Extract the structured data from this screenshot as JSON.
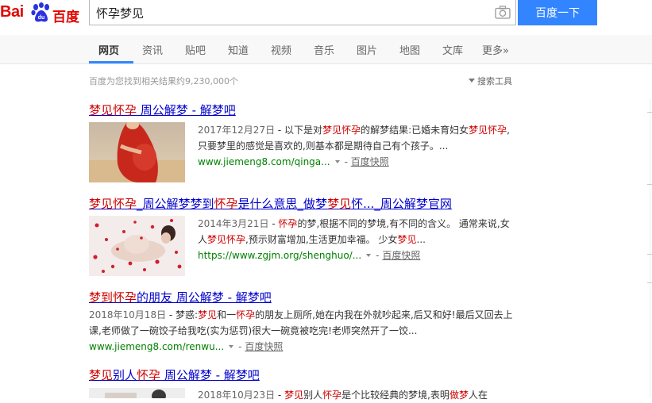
{
  "logo": {
    "latin": "Bai",
    "chinese": "百度"
  },
  "search": {
    "query": "怀孕梦见",
    "button_label": "百度一下"
  },
  "tabs": [
    {
      "label": "网页"
    },
    {
      "label": "资讯"
    },
    {
      "label": "贴吧"
    },
    {
      "label": "知道"
    },
    {
      "label": "视频"
    },
    {
      "label": "音乐"
    },
    {
      "label": "图片"
    },
    {
      "label": "地图"
    },
    {
      "label": "文库"
    },
    {
      "label": "更多»"
    }
  ],
  "stats": {
    "text": "百度为您找到相关结果约9,230,000个",
    "tools_label": "搜索工具"
  },
  "results": [
    {
      "title_parts": [
        "梦见",
        "怀孕",
        " 周公解梦 - 解梦吧"
      ],
      "date": "2017年12月27日",
      "snippet_parts": [
        " - 以下是对",
        "梦见怀孕",
        "的解梦结果:已婚未育妇女",
        "梦见",
        "怀孕",
        ",只要梦里的感觉是喜欢的,则基本都是期待自己有个孩子。..."
      ],
      "url": "www.jiemeng8.com/qinga...",
      "snapshot": "百度快照"
    },
    {
      "title_parts": [
        "梦见怀孕",
        "_周公解梦梦到",
        "怀孕",
        "是什么意思_做梦",
        "梦见",
        "怀..._周公解梦官网"
      ],
      "date": "2014年3月21日",
      "snippet_parts": [
        " - ",
        "怀孕",
        "的梦,根据不同的梦境,有不同的含义。 通常来说,女人",
        "梦见怀孕",
        ",预示财富增加,生活更加幸福。 少女",
        "梦见",
        "..."
      ],
      "url": "https://www.zgjm.org/shenghuo/...",
      "snapshot": "百度快照"
    },
    {
      "title_parts": [
        "梦到",
        "怀孕",
        "的朋友 周公解梦 - 解梦吧"
      ],
      "date": "2018年10月18日",
      "snippet_parts": [
        " - 梦惑:",
        "梦见",
        "和一",
        "怀孕",
        "的朋友上厕所,她在内我在外就吵起来,后又和好!最后又回去上课,老师做了一碗饺子给我吃(实为惩罚)很大一碗竟被吃完!老师突然开了一饺..."
      ],
      "url": "www.jiemeng8.com/renwu...",
      "snapshot": "百度快照"
    },
    {
      "title_parts": [
        "梦见",
        "别人",
        "怀孕",
        " 周公解梦 - 解梦吧"
      ],
      "date": "2018年10月23日",
      "snippet_parts": [
        " - ",
        "梦见",
        "别人",
        "怀孕",
        "是个比较经典的梦境,表明",
        "做梦",
        "人在"
      ]
    }
  ],
  "colors": {
    "brand_red": "#e10601",
    "brand_blue": "#2932e1",
    "button_blue": "#3385ff",
    "link": "#0000cc",
    "highlight": "#cc0000",
    "url_green": "#008000"
  },
  "icons": [
    "baidu-paw-icon",
    "camera-icon",
    "funnel-icon",
    "chevron-down-icon"
  ]
}
